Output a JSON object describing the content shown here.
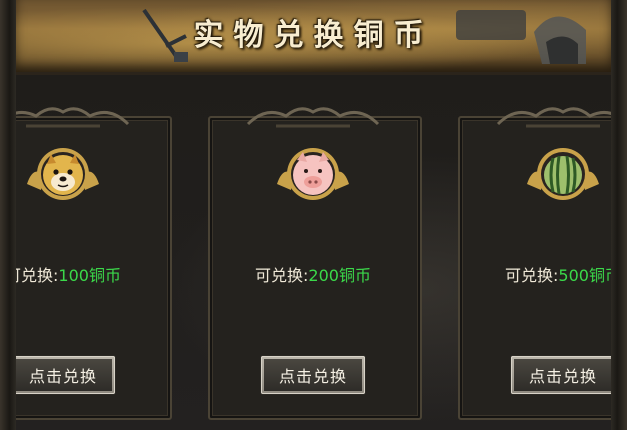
{
  "banner": {
    "title": "实物兑换铜币"
  },
  "cards": [
    {
      "icon": "doge-icon",
      "price_prefix": "可兑换:",
      "price_value": "100",
      "price_unit": "铜币",
      "button_label": "点击兑换"
    },
    {
      "icon": "pig-icon",
      "price_prefix": "可兑换:",
      "price_value": "200",
      "price_unit": "铜币",
      "button_label": "点击兑换"
    },
    {
      "icon": "watermelon-icon",
      "price_prefix": "可兑换:",
      "price_value": "500",
      "price_unit": "铜币",
      "button_label": "点击兑换"
    }
  ],
  "colors": {
    "price_value": "#3bd94a",
    "price_text": "#f0e9d8",
    "gold": "#c9a24a"
  }
}
